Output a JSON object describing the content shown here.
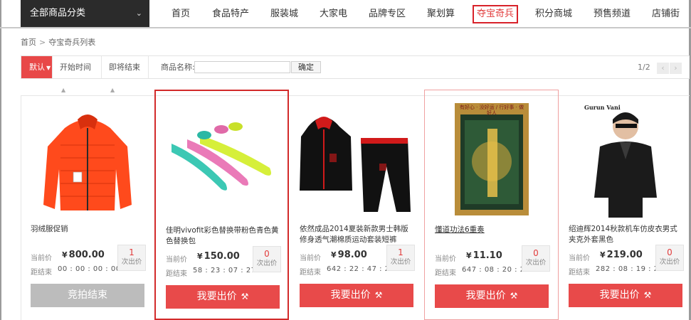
{
  "nav": {
    "category_button": "全部商品分类",
    "items": [
      "首页",
      "食品特产",
      "服装城",
      "大家电",
      "品牌专区",
      "聚划算",
      "夺宝奇兵",
      "积分商城",
      "预售频道",
      "店铺街"
    ],
    "active_item": "夺宝奇兵"
  },
  "breadcrumb": {
    "home": "首页",
    "separator": ">",
    "current": "夺宝奇兵列表"
  },
  "filter": {
    "sort_options": [
      "默认",
      "开始时间",
      "即将结束"
    ],
    "name_label": "商品名称:",
    "name_value": "",
    "confirm_label": "确定",
    "page_info": "1/2",
    "prev_icon": "chevron-left-icon",
    "next_icon": "chevron-right-icon"
  },
  "labels": {
    "current_price": "当前价",
    "remaining": "距结束",
    "bid_unit": "次出价"
  },
  "products": [
    {
      "title": "羽绒服促销",
      "currency": "¥",
      "price": "800.00",
      "countdown": "00 : 00 : 00 : 00",
      "bids": "1",
      "button": "竞拍结束",
      "ended": true,
      "image": "orange-down-jacket"
    },
    {
      "title": "佳明vivofit彩色替换带粉色青色黄色替换包",
      "currency": "¥",
      "price": "150.00",
      "countdown": "58 : 23 : 07 : 27",
      "bids": "0",
      "button": "我要出价",
      "ended": false,
      "image": "colored-fitness-bands"
    },
    {
      "title": "依然成品2014夏装新款男士韩版修身透气潮棉质运动套装短裤",
      "currency": "¥",
      "price": "98.00",
      "countdown": "642 : 22 : 47 : 27",
      "bids": "1",
      "button": "我要出价",
      "ended": false,
      "image": "black-red-tracksuit"
    },
    {
      "title": "懂道功法6重奏",
      "currency": "¥",
      "price": "11.10",
      "countdown": "647 : 08 : 20 : 27",
      "bids": "0",
      "button": "我要出价",
      "ended": false,
      "image": "book-cover",
      "book_header": "有好心 · 没好运 / 行好事 · 做好人"
    },
    {
      "title": "绍迪辉2014秋款机车仿皮衣男式夹克外套黑色",
      "currency": "¥",
      "price": "219.00",
      "countdown": "282 : 08 : 19 : 27",
      "bids": "0",
      "button": "我要出价",
      "ended": false,
      "image": "leather-jacket-model",
      "brand": "Gurun Vani"
    }
  ],
  "colors": {
    "accent": "#e84a4a",
    "active_nav": "#d8222a",
    "dark_bar": "#2b2b2b",
    "ended": "#bcbcbc"
  }
}
